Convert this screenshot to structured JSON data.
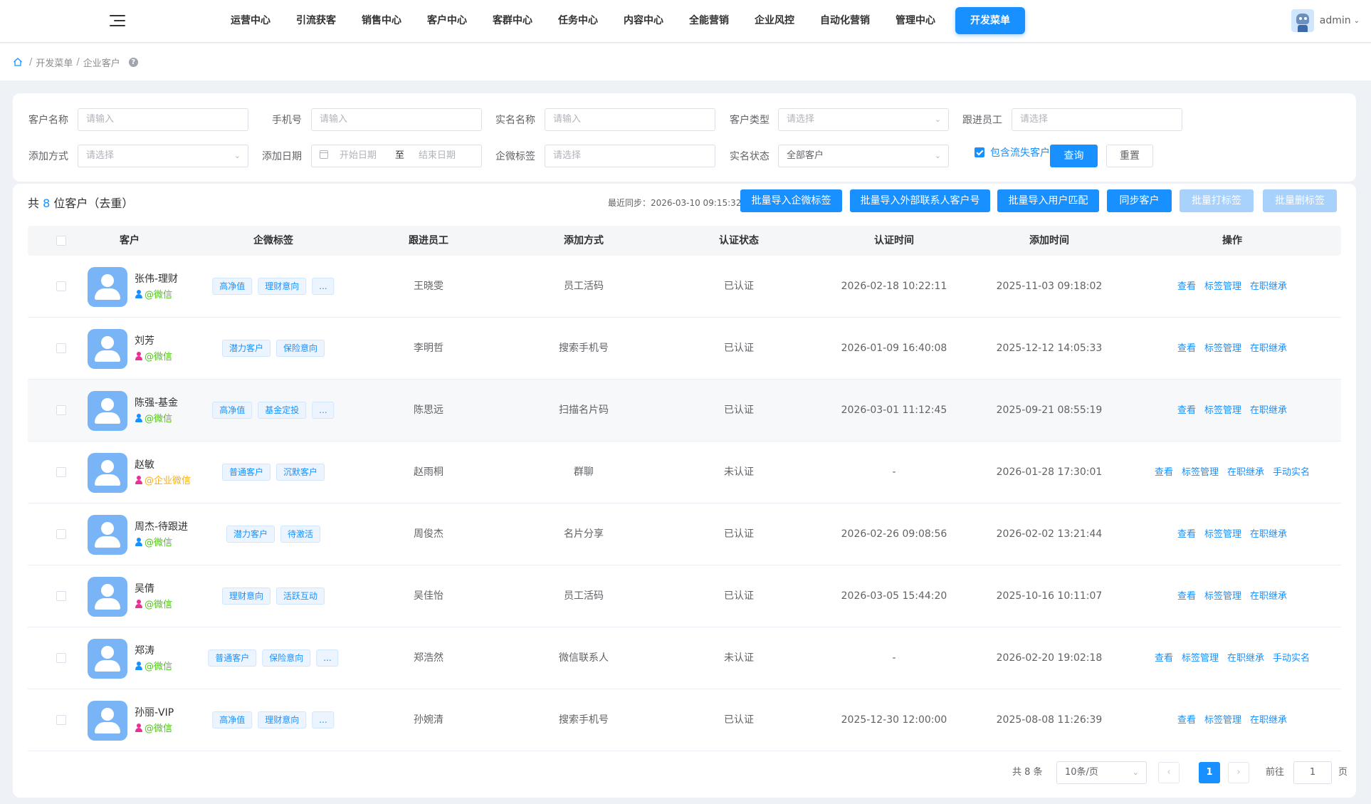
{
  "topnav": {
    "menu": [
      "运营中心",
      "引流获客",
      "销售中心",
      "客户中心",
      "客群中心",
      "任务中心",
      "内容中心",
      "全能营销",
      "企业风控",
      "自动化营销",
      "管理中心"
    ],
    "active_menu": "开发菜单",
    "user": "admin"
  },
  "breadcrumb": {
    "items": [
      "开发菜单",
      "企业客户"
    ],
    "help": "?"
  },
  "filters": {
    "customer_name": {
      "label": "客户名称",
      "placeholder": "请输入"
    },
    "phone": {
      "label": "手机号",
      "placeholder": "请输入"
    },
    "real_name": {
      "label": "实名名称",
      "placeholder": "请输入"
    },
    "customer_type": {
      "label": "客户类型",
      "placeholder": "请选择"
    },
    "follow_staff": {
      "label": "跟进员工",
      "placeholder": "请选择"
    },
    "add_method": {
      "label": "添加方式",
      "placeholder": "请选择"
    },
    "add_date": {
      "label": "添加日期",
      "start": "开始日期",
      "sep": "至",
      "end": "结束日期"
    },
    "wecom_tag": {
      "label": "企微标签",
      "placeholder": "请选择"
    },
    "real_status": {
      "label": "实名状态",
      "value": "全部客户"
    },
    "include_lost": {
      "label": "包含流失客户",
      "checked": true
    },
    "query_button": "查询",
    "reset_button": "重置"
  },
  "toolbar": {
    "summary_prefix": "共",
    "summary_count": "8",
    "summary_suffix": "位客户（去重）",
    "last_sync": "最近同步：2026-03-10 09:15:32",
    "buttons": [
      {
        "label": "批量导入企微标签",
        "disabled": false
      },
      {
        "label": "批量导入外部联系人客户号",
        "disabled": false
      },
      {
        "label": "批量导入用户匹配",
        "disabled": false
      },
      {
        "label": "同步客户",
        "disabled": false
      },
      {
        "label": "批量打标签",
        "disabled": true
      },
      {
        "label": "批量删标签",
        "disabled": true
      }
    ]
  },
  "table": {
    "columns": [
      "客户",
      "企微标签",
      "跟进员工",
      "添加方式",
      "认证状态",
      "认证时间",
      "添加时间",
      "操作"
    ],
    "rows": [
      {
        "name": "张伟-理财",
        "source": "@微信",
        "gender": "male",
        "tags": [
          "高净值",
          "理财意向",
          "..."
        ],
        "staff": "王晓雯",
        "method": "员工活码",
        "status": "已认证",
        "auth_time": "2026-02-18 10:22:11",
        "add_time": "2025-11-03 09:18:02",
        "ops": [
          "查看",
          "标签管理",
          "在职继承"
        ]
      },
      {
        "name": "刘芳",
        "source": "@微信",
        "gender": "female",
        "tags": [
          "潜力客户",
          "保险意向"
        ],
        "staff": "李明哲",
        "method": "搜索手机号",
        "status": "已认证",
        "auth_time": "2026-01-09 16:40:08",
        "add_time": "2025-12-12 14:05:33",
        "ops": [
          "查看",
          "标签管理",
          "在职继承"
        ]
      },
      {
        "name": "陈强-基金",
        "source": "@微信",
        "gender": "male",
        "tags": [
          "高净值",
          "基金定投",
          "..."
        ],
        "staff": "陈思远",
        "method": "扫描名片码",
        "status": "已认证",
        "auth_time": "2026-03-01 11:12:45",
        "add_time": "2025-09-21 08:55:19",
        "ops": [
          "查看",
          "标签管理",
          "在职继承"
        ]
      },
      {
        "name": "赵敏",
        "source": "@企业微信",
        "gender": "female",
        "tags": [
          "普通客户",
          "沉默客户"
        ],
        "staff": "赵雨桐",
        "method": "群聊",
        "status": "未认证",
        "auth_time": "-",
        "add_time": "2026-01-28 17:30:01",
        "ops": [
          "查看",
          "标签管理",
          "在职继承",
          "手动实名"
        ]
      },
      {
        "name": "周杰-待跟进",
        "source": "@微信",
        "gender": "male",
        "tags": [
          "潜力客户",
          "待激活"
        ],
        "staff": "周俊杰",
        "method": "名片分享",
        "status": "已认证",
        "auth_time": "2026-02-26 09:08:56",
        "add_time": "2026-02-02 13:21:44",
        "ops": [
          "查看",
          "标签管理",
          "在职继承"
        ]
      },
      {
        "name": "吴倩",
        "source": "@微信",
        "gender": "female",
        "tags": [
          "理财意向",
          "活跃互动"
        ],
        "staff": "吴佳怡",
        "method": "员工活码",
        "status": "已认证",
        "auth_time": "2026-03-05 15:44:20",
        "add_time": "2025-10-16 10:11:07",
        "ops": [
          "查看",
          "标签管理",
          "在职继承"
        ]
      },
      {
        "name": "郑涛",
        "source": "@微信",
        "gender": "male",
        "tags": [
          "普通客户",
          "保险意向",
          "..."
        ],
        "staff": "郑浩然",
        "method": "微信联系人",
        "status": "未认证",
        "auth_time": "-",
        "add_time": "2026-02-20 19:02:18",
        "ops": [
          "查看",
          "标签管理",
          "在职继承",
          "手动实名"
        ]
      },
      {
        "name": "孙丽-VIP",
        "source": "@微信",
        "gender": "female",
        "tags": [
          "高净值",
          "理财意向",
          "..."
        ],
        "staff": "孙婉清",
        "method": "搜索手机号",
        "status": "已认证",
        "auth_time": "2025-12-30 12:00:00",
        "add_time": "2025-08-08 11:26:39",
        "ops": [
          "查看",
          "标签管理",
          "在职继承"
        ]
      }
    ]
  },
  "pagination": {
    "total": "共 8 条",
    "page_size": "10条/页",
    "prev": "‹",
    "current": "1",
    "next": "›",
    "goto_label": "前往",
    "goto_value": "1",
    "page_label": "页"
  },
  "colors": {
    "primary": "#1890ff",
    "wechat_green": "#52c41a",
    "wecom_orange": "#faad14",
    "female_pink": "#eb2f96",
    "male_blue": "#1890ff",
    "avatar_blue": "#79b4f7"
  }
}
